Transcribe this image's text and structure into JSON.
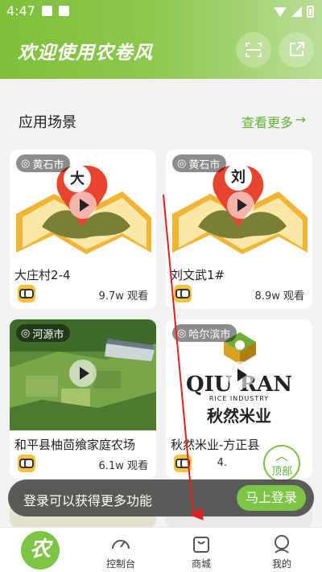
{
  "status_bar": {
    "time": "4:47"
  },
  "header": {
    "title": "欢迎使用农卷风",
    "scan_icon": "scan-icon",
    "share_icon": "share-icon",
    "bg_color": "#8cc84b"
  },
  "section": {
    "title": "应用场景",
    "see_more": "查看更多",
    "see_more_arrow": "→"
  },
  "cards": [
    {
      "location": "黄石市",
      "pin_char": "大",
      "title": "大庄村2-4",
      "views": "9.7w 观看"
    },
    {
      "location": "黄石市",
      "pin_char": "刘",
      "title": "刘文武1#",
      "views": "8.9w 观看"
    },
    {
      "location": "河源市",
      "title": "和平县柚茴飨家庭农场",
      "views": "6.1w 观看"
    },
    {
      "location": "哈尔滨市",
      "title": "秋然米业-方正县",
      "views": "4.",
      "logo_text": "QIU RAN",
      "logo_sub": "RICE INDUSTRY",
      "logo_cn": "秋然米业"
    }
  ],
  "top_button": {
    "label": "顶部",
    "chevron": "︿"
  },
  "login_banner": {
    "text": "登录可以获得更多功能",
    "button": "马上登录"
  },
  "tabbar": {
    "home_logo": "农",
    "items": [
      {
        "label": "控制台",
        "icon": "dashboard-icon"
      },
      {
        "label": "商城",
        "icon": "shop-bag-icon"
      },
      {
        "label": "我的",
        "icon": "profile-icon"
      }
    ]
  },
  "accent_color": "#7cc443"
}
